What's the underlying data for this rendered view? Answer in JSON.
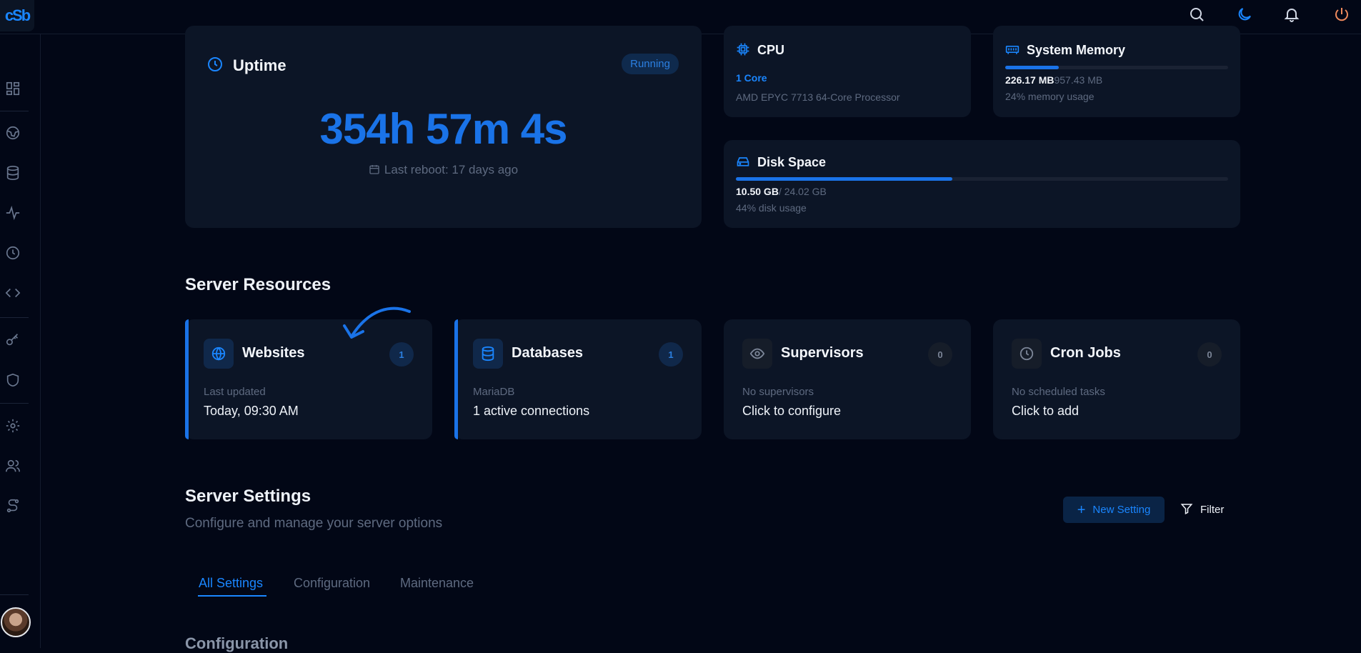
{
  "header": {
    "logo_text": "cSb",
    "icons": [
      "search-icon",
      "moon-icon",
      "bell-icon",
      "power-icon"
    ]
  },
  "sidebar": {
    "icons": [
      "dashboard-icon",
      "globe-icon",
      "database-icon",
      "activity-icon",
      "clock-icon",
      "code-icon",
      "key-icon",
      "shield-icon",
      "settings-icon",
      "users-icon",
      "route-icon"
    ]
  },
  "uptime": {
    "title": "Uptime",
    "status": "Running",
    "value": "354h 57m 4s",
    "last_reboot": "Last reboot: 17 days ago"
  },
  "cpu": {
    "title": "CPU",
    "cores": "1 Core",
    "model": "AMD EPYC 7713 64-Core Processor"
  },
  "memory": {
    "title": "System Memory",
    "used": "226.17 MB",
    "total": "957.43 MB",
    "usage_text": "24% memory usage",
    "usage_fraction": 0.24
  },
  "disk": {
    "title": "Disk Space",
    "used": "10.50 GB",
    "total": "/ 24.02 GB",
    "usage_text": "44% disk usage",
    "usage_fraction": 0.44
  },
  "resources": {
    "title": "Server Resources",
    "cards": [
      {
        "title": "Websites",
        "count": "1",
        "sub": "Last updated",
        "value": "Today, 09:30 AM",
        "icon": "globe-icon",
        "active": true
      },
      {
        "title": "Databases",
        "count": "1",
        "sub": "MariaDB",
        "value": "1 active connections",
        "icon": "database-icon",
        "active": true
      },
      {
        "title": "Supervisors",
        "count": "0",
        "sub": "No supervisors",
        "value": "Click to configure",
        "icon": "eye-icon",
        "active": false
      },
      {
        "title": "Cron Jobs",
        "count": "0",
        "sub": "No scheduled tasks",
        "value": "Click to add",
        "icon": "clock-icon",
        "active": false
      }
    ]
  },
  "settings": {
    "title": "Server Settings",
    "subtitle": "Configure and manage your server options",
    "new_button": "New Setting",
    "filter_button": "Filter",
    "tabs": [
      "All Settings",
      "Configuration",
      "Maintenance"
    ],
    "active_tab": "All Settings",
    "section_heading": "Configuration"
  },
  "colors": {
    "accent": "#1a86ff",
    "background": "#020716",
    "card": "#0c1526"
  }
}
